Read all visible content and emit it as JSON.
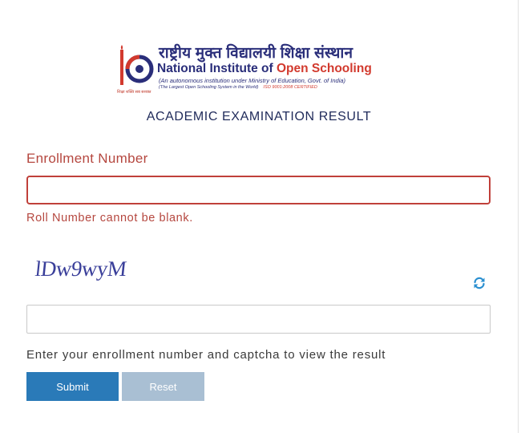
{
  "logo": {
    "hindi": "राष्ट्रीय मुक्त विद्यालयी शिक्षा संस्थान",
    "english_main": "National Institute of ",
    "english_accent": "Open Schooling",
    "sub1": "(An autonomous institution under Ministry of Education, Govt. of India)",
    "sub2": "(The Largest Open Schooling System in the World)",
    "iso": "ISO 9001:2008 CERTIFIED",
    "caption": "शिक्षा शक्ति सब सशक्त"
  },
  "title": "ACADEMIC EXAMINATION RESULT",
  "enrollment": {
    "label": "Enrollment Number",
    "value": "",
    "error": "Roll Number cannot be blank."
  },
  "captcha": {
    "text": "lDw9wyM",
    "value": ""
  },
  "help_text": "Enter your enrollment number and captcha to view the result",
  "buttons": {
    "submit": "Submit",
    "reset": "Reset"
  },
  "colors": {
    "brand_navy": "#2a2e7a",
    "brand_red": "#d23a2e",
    "error": "#b5473f",
    "submit": "#2a7ab8",
    "reset": "#a9bfd3",
    "refresh_icon": "#2a8fd0"
  }
}
